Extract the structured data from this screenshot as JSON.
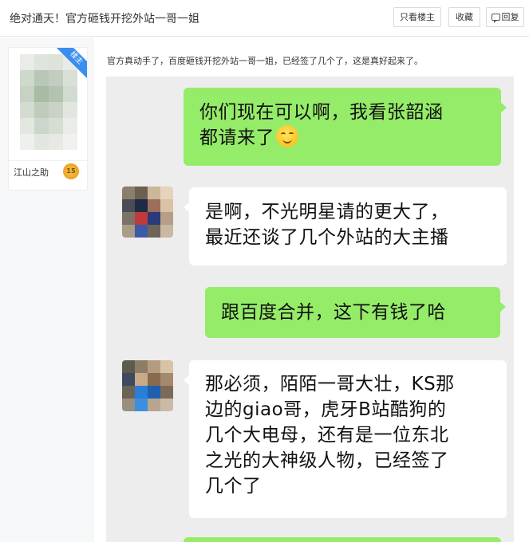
{
  "header": {
    "title": "绝对通天！官方砸钱开挖外站一哥一姐",
    "buttons": {
      "only_op": "只看楼主",
      "favorite": "收藏",
      "reply": "回复"
    }
  },
  "author": {
    "badge": "楼主",
    "name": "江山之助",
    "level": "15"
  },
  "post": {
    "text": "官方真动手了，百度砸钱开挖外站一哥一姐，已经签了几个了，这是真好起来了。"
  },
  "chat": {
    "messages": [
      {
        "side": "right",
        "lines": [
          "你们现在可以啊，我看张韶涵",
          "都请来了"
        ],
        "emoji": "grin-emoji"
      },
      {
        "side": "left",
        "lines": [
          "是啊，不光明星请的更大了，",
          "最近还谈了几个外站的大主播"
        ]
      },
      {
        "side": "right",
        "lines": [
          "跟百度合并，这下有钱了哈"
        ]
      },
      {
        "side": "left",
        "lines": [
          "那必须，陌陌一哥大壮，KS那",
          "边的giao哥，虎牙B站酷狗的",
          "几个大电母，还有是一位东北",
          "之光的大神级人物，已经签了",
          "几个了"
        ]
      }
    ]
  },
  "colors": {
    "sent_bubble": "#95ec69",
    "received_bubble": "#ffffff",
    "chat_background": "#ededed",
    "badge_blue": "#3b8ef0"
  }
}
